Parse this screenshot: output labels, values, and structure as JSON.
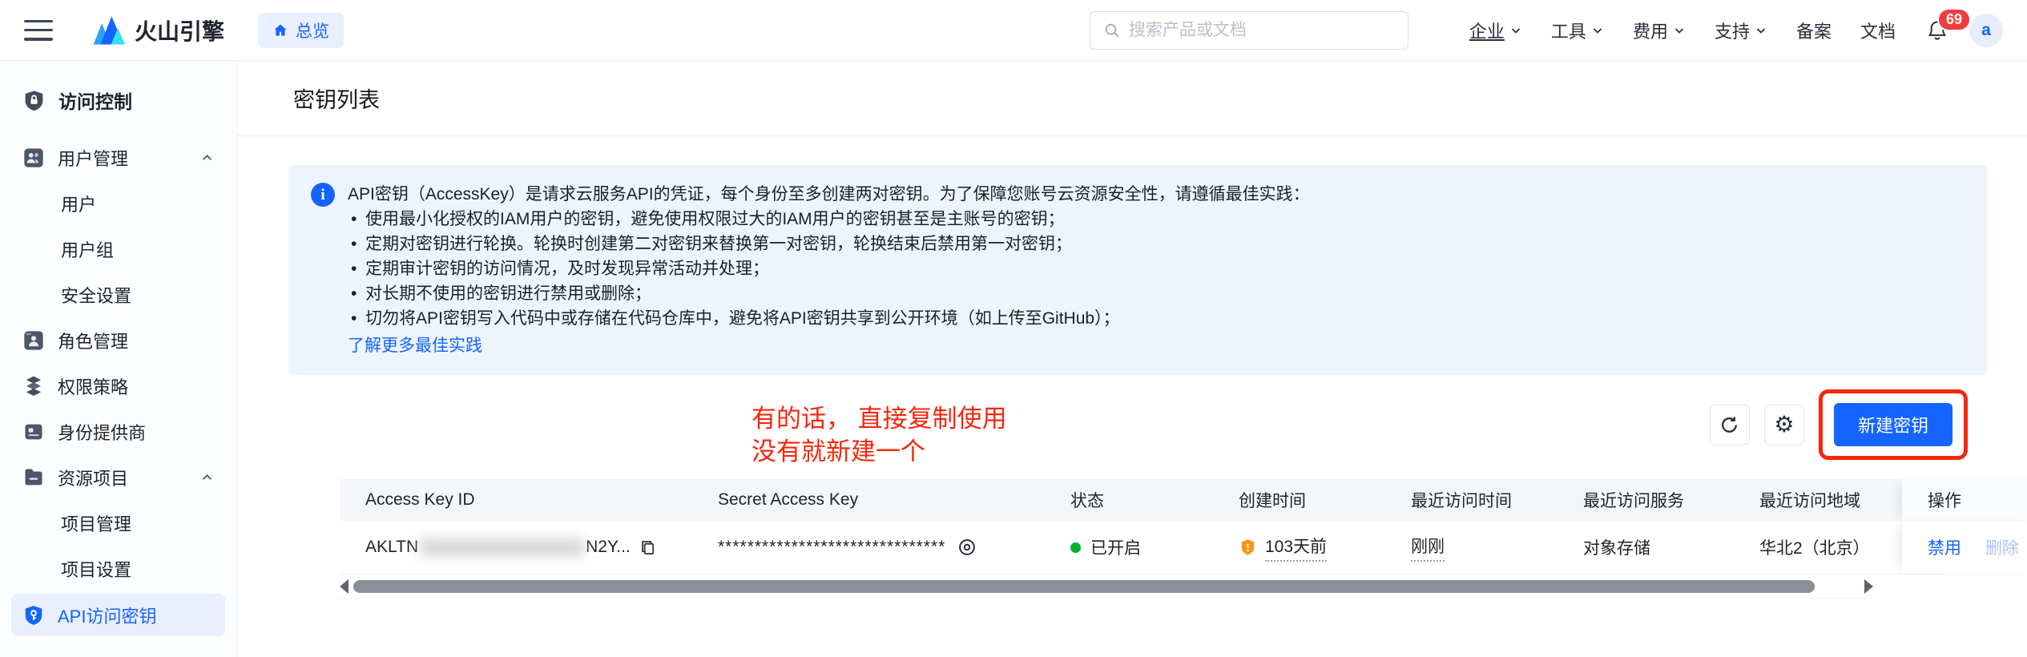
{
  "navbar": {
    "brand": "火山引擎",
    "overview_tab": "总览",
    "search_placeholder": "搜索产品或文档",
    "menus": [
      {
        "label": "企业",
        "dropdown": true
      },
      {
        "label": "工具",
        "dropdown": true
      },
      {
        "label": "费用",
        "dropdown": true
      },
      {
        "label": "支持",
        "dropdown": true
      },
      {
        "label": "备案",
        "dropdown": false
      },
      {
        "label": "文档",
        "dropdown": false
      }
    ],
    "notification_count": "69",
    "avatar_text": "a"
  },
  "sidebar": {
    "title": "访问控制",
    "items": [
      {
        "label": "用户管理"
      },
      {
        "label": "用户"
      },
      {
        "label": "用户组"
      },
      {
        "label": "安全设置"
      },
      {
        "label": "角色管理"
      },
      {
        "label": "权限策略"
      },
      {
        "label": "身份提供商"
      },
      {
        "label": "资源项目"
      },
      {
        "label": "项目管理"
      },
      {
        "label": "项目设置"
      },
      {
        "label": "API访问密钥"
      }
    ],
    "selected": "API访问密钥"
  },
  "page": {
    "title": "密钥列表"
  },
  "banner": {
    "intro": "API密钥（AccessKey）是请求云服务API的凭证，每个身份至多创建两对密钥。为了保障您账号云资源安全性，请遵循最佳实践：",
    "bullets": [
      "使用最小化授权的IAM用户的密钥，避免使用权限过大的IAM用户的密钥甚至是主账号的密钥；",
      "定期对密钥进行轮换。轮换时创建第二对密钥来替换第一对密钥，轮换结束后禁用第一对密钥；",
      "定期审计密钥的访问情况，及时发现异常活动并处理；",
      "对长期不使用的密钥进行禁用或删除；",
      "切勿将API密钥写入代码中或存储在代码仓库中，避免将API密钥共享到公开环境（如上传至GitHub）；"
    ],
    "link": "了解更多最佳实践"
  },
  "annotation": {
    "line1": "有的话， 直接复制使用",
    "line2": "没有就新建一个",
    "color": "#f5270c"
  },
  "toolbar": {
    "create_button": "新建密钥"
  },
  "table": {
    "headers": [
      "Access Key ID",
      "Secret Access Key",
      "状态",
      "创建时间",
      "最近访问时间",
      "最近访问服务",
      "最近访问地域",
      "操作"
    ],
    "row": {
      "access_key_prefix": "AKLTN",
      "access_key_suffix": "N2Y...",
      "access_key_redacted": true,
      "secret_masked": "*******************************",
      "status": "已开启",
      "created": "103天前",
      "last_access_time": "刚刚",
      "last_access_service": "对象存储",
      "last_access_region": "华北2（北京）",
      "action_disable": "禁用",
      "action_delete": "删除"
    }
  },
  "colors": {
    "accent": "#1664ff",
    "status_green": "#00b42a",
    "warning_orange": "#ff9214",
    "badge_red": "#f23c3c",
    "annotation_red": "#f5270c"
  }
}
